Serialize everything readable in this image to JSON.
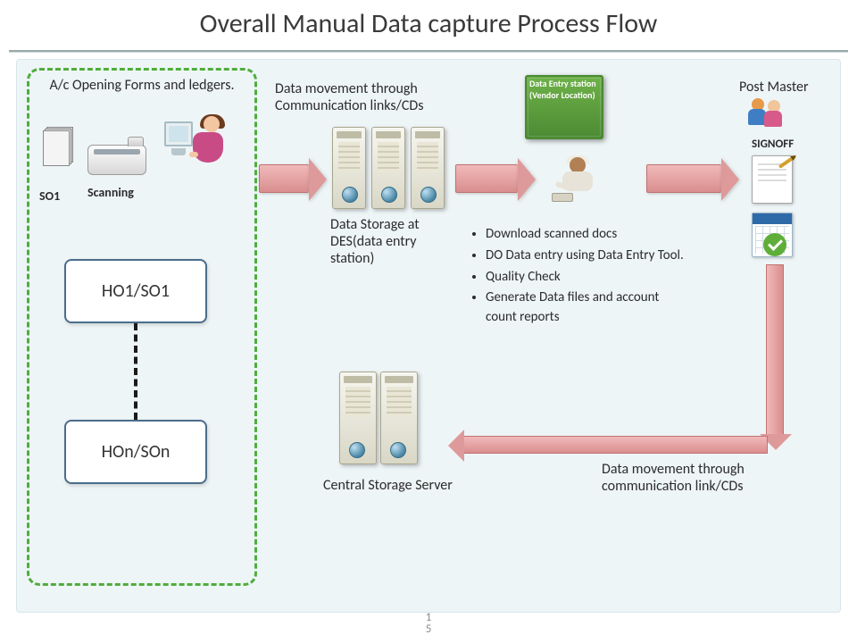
{
  "title": "Overall Manual Data capture Process Flow",
  "page_number": "1\n5",
  "dashed": {
    "heading": "A/c Opening Forms and ledgers.",
    "so_label": "SO1",
    "scan_label": "Scanning",
    "node1": "HO1/SO1",
    "node2": "HOn/SOn"
  },
  "flow": {
    "comm_label": "Data movement through Communication links/CDs",
    "des_label": "Data Storage at DES(data entry station)",
    "green_box": "Data Entry station (Vendor Location)",
    "bullets": [
      "Download scanned docs",
      "DO Data entry  using Data Entry Tool.",
      "Quality Check",
      "Generate Data files and  account count reports"
    ],
    "post_master": "Post Master",
    "signoff": "SIGNOFF",
    "central": "Central Storage Server",
    "return_label": "Data movement through communication link/CDs"
  }
}
